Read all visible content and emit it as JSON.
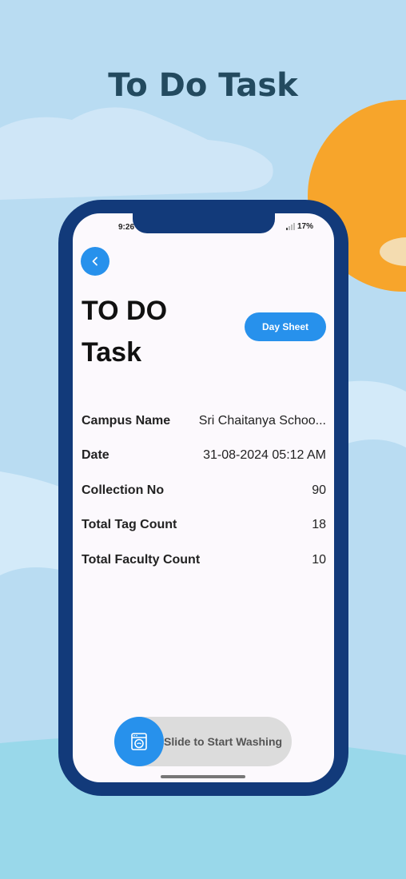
{
  "header": {
    "title": "To Do Task"
  },
  "status_bar": {
    "time": "9:26",
    "battery": "17%"
  },
  "page": {
    "title": "TO DO Task",
    "day_sheet_label": "Day Sheet"
  },
  "details": [
    {
      "label": "Campus Name",
      "value": "Sri Chaitanya Schoo..."
    },
    {
      "label": "Date",
      "value": "31-08-2024 05:12 AM"
    },
    {
      "label": "Collection No",
      "value": "90"
    },
    {
      "label": "Total Tag Count",
      "value": "18"
    },
    {
      "label": "Total Faculty Count",
      "value": "10"
    }
  ],
  "slider": {
    "label": "Slide to Start Washing"
  },
  "icons": {
    "back": "chevron-left-icon",
    "knob": "washing-machine-icon",
    "signal": "signal-icon"
  },
  "colors": {
    "accent": "#2791ec",
    "phone_frame": "#123a7a",
    "hero_title": "#234a5f",
    "sun": "#f7a52b",
    "sky": "#b9dcf2"
  }
}
